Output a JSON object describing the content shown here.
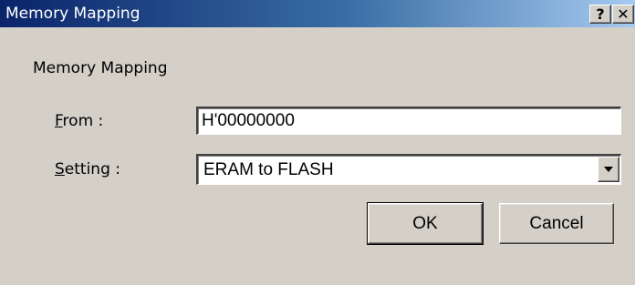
{
  "window": {
    "title": "Memory Mapping",
    "help_glyph": "?",
    "close_glyph": "✕"
  },
  "group": {
    "label": "Memory Mapping"
  },
  "from": {
    "mnemonic": "F",
    "label_rest": "rom :",
    "value": "H'00000000"
  },
  "setting": {
    "mnemonic": "S",
    "label_rest": "etting :",
    "selected": "ERAM to FLASH"
  },
  "buttons": {
    "ok": "OK",
    "cancel": "Cancel"
  }
}
